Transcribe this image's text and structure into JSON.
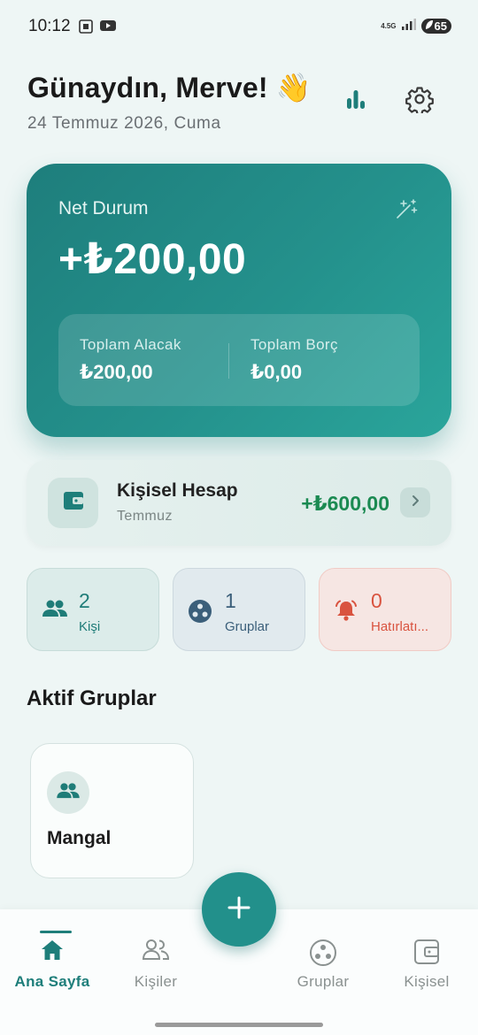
{
  "status_bar": {
    "time": "10:12",
    "network": "4.5G",
    "battery": "65"
  },
  "header": {
    "greeting": "Günaydın, Merve! 👋",
    "date": "24 Temmuz 2026, Cuma",
    "icons": [
      "bar-chart-icon",
      "gear-icon"
    ]
  },
  "net_card": {
    "label": "Net Durum",
    "amount": "+₺200,00",
    "receivable_label": "Toplam Alacak",
    "receivable_value": "₺200,00",
    "debt_label": "Toplam Borç",
    "debt_value": "₺0,00"
  },
  "personal_account": {
    "title": "Kişisel Hesap",
    "subtitle": "Temmuz",
    "amount": "+₺600,00",
    "amount_color": "#1b8a52"
  },
  "stats": [
    {
      "count": "2",
      "label": "Kişi",
      "icon": "people-icon"
    },
    {
      "count": "1",
      "label": "Gruplar",
      "icon": "groups-icon"
    },
    {
      "count": "0",
      "label": "Hatırlatı...",
      "icon": "bell-icon"
    }
  ],
  "active_groups": {
    "title": "Aktif Gruplar",
    "items": [
      {
        "name": "Mangal",
        "icon": "people-icon"
      }
    ]
  },
  "bottom_nav": [
    {
      "label": "Ana Sayfa",
      "icon": "home-icon",
      "active": true
    },
    {
      "label": "Kişiler",
      "icon": "people-outline-icon",
      "active": false
    },
    {
      "label": "Gruplar",
      "icon": "groups-outline-icon",
      "active": false
    },
    {
      "label": "Kişisel",
      "icon": "wallet-outline-icon",
      "active": false
    }
  ],
  "colors": {
    "accent": "#22908b",
    "background": "#eef6f5",
    "positive": "#1b8a52",
    "alert": "#d9533f"
  }
}
